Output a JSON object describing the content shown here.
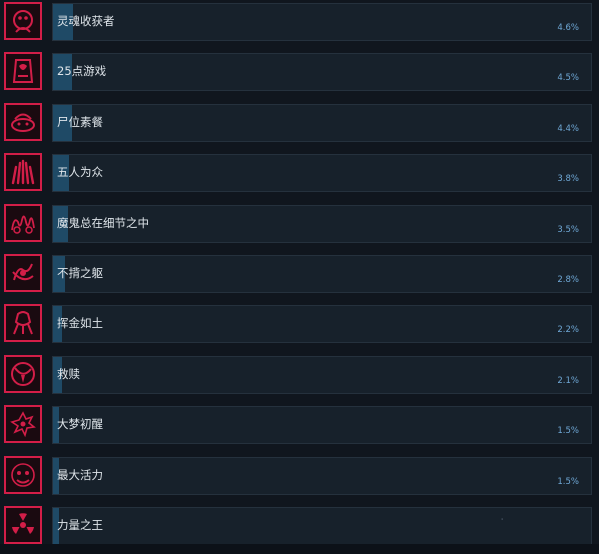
{
  "accent_color": "#d21e48",
  "bar_color": "#1f4a66",
  "achievements": [
    {
      "name": "灵魂收获者",
      "percent": "4.6%",
      "progress": 0.046,
      "icon": "soul-reaper-icon"
    },
    {
      "name": "25点游戏",
      "percent": "4.5%",
      "progress": 0.045,
      "icon": "blackjack-icon"
    },
    {
      "name": "尸位素餐",
      "percent": "4.4%",
      "progress": 0.044,
      "icon": "feast-icon"
    },
    {
      "name": "五人为众",
      "percent": "3.8%",
      "progress": 0.038,
      "icon": "five-hands-icon"
    },
    {
      "name": "魔鬼总在细节之中",
      "percent": "3.5%",
      "progress": 0.035,
      "icon": "devil-details-icon"
    },
    {
      "name": "不揹之躯",
      "percent": "2.8%",
      "progress": 0.028,
      "icon": "body-icon"
    },
    {
      "name": "挥金如土",
      "percent": "2.2%",
      "progress": 0.022,
      "icon": "gold-icon"
    },
    {
      "name": "救赎",
      "percent": "2.1%",
      "progress": 0.021,
      "icon": "redemption-icon"
    },
    {
      "name": "大梦初醒",
      "percent": "1.5%",
      "progress": 0.015,
      "icon": "awaken-icon"
    },
    {
      "name": "最大活力",
      "percent": "1.5%",
      "progress": 0.015,
      "icon": "vitality-icon"
    },
    {
      "name": "力量之王",
      "percent": "",
      "progress": 0.012,
      "icon": "radiation-icon"
    }
  ]
}
